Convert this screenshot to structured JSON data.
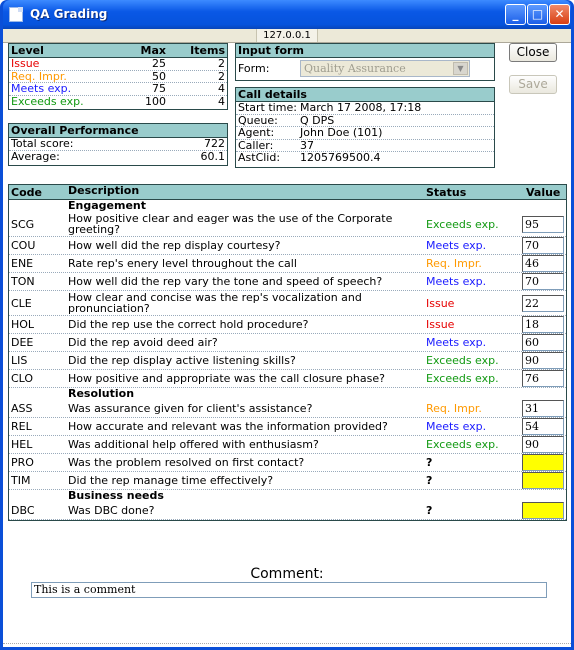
{
  "window": {
    "title": "QA Grading"
  },
  "address": "127.0.0.1",
  "levels": {
    "headers": [
      "Level",
      "Max",
      "Items"
    ],
    "rows": [
      {
        "label": "Issue",
        "max": "25",
        "items": "2",
        "cls": "c-issue"
      },
      {
        "label": "Req. Impr.",
        "max": "50",
        "items": "2",
        "cls": "c-req"
      },
      {
        "label": "Meets exp.",
        "max": "75",
        "items": "4",
        "cls": "c-meets"
      },
      {
        "label": "Exceeds exp.",
        "max": "100",
        "items": "4",
        "cls": "c-exceeds"
      }
    ]
  },
  "performance": {
    "title": "Overall Performance",
    "total_label": "Total score:",
    "total_value": "722",
    "avg_label": "Average:",
    "avg_value": "60.1"
  },
  "input_form": {
    "title": "Input form",
    "form_label": "Form:",
    "form_value": "Quality Assurance"
  },
  "call_details": {
    "title": "Call details",
    "rows": [
      {
        "k": "Start time:",
        "v": "March 17 2008, 17:18"
      },
      {
        "k": "Queue:",
        "v": "Q DPS"
      },
      {
        "k": "Agent:",
        "v": "John Doe (101)"
      },
      {
        "k": "Caller:",
        "v": "37"
      },
      {
        "k": "AstClid:",
        "v": "1205769500.4"
      }
    ]
  },
  "buttons": {
    "close": "Close",
    "save": "Save"
  },
  "table": {
    "headers": {
      "code": "Code",
      "desc": "Description",
      "status": "Status",
      "value": "Value"
    },
    "sections": [
      {
        "title": "Engagement",
        "rows": [
          {
            "code": "SCG",
            "desc": "How positive clear and eager was the use of the Corporate greeting?",
            "status": "Exceeds exp.",
            "cls": "c-exceeds",
            "value": "95",
            "tall": true
          },
          {
            "code": "COU",
            "desc": "How well did the rep display courtesy?",
            "status": "Meets exp.",
            "cls": "c-meets",
            "value": "70"
          },
          {
            "code": "ENE",
            "desc": "Rate rep's enery level throughout the call",
            "status": "Req. Impr.",
            "cls": "c-req",
            "value": "46"
          },
          {
            "code": "TON",
            "desc": "How well did the rep vary the tone and speed of speech?",
            "status": "Meets exp.",
            "cls": "c-meets",
            "value": "70"
          },
          {
            "code": "CLE",
            "desc": "How clear and concise was the rep's vocalization and pronunciation?",
            "status": "Issue",
            "cls": "c-issue",
            "value": "22",
            "tall": true
          },
          {
            "code": "HOL",
            "desc": "Did the rep use the correct hold procedure?",
            "status": "Issue",
            "cls": "c-issue",
            "value": "18"
          },
          {
            "code": "DEE",
            "desc": "Did the rep avoid deed air?",
            "status": "Meets exp.",
            "cls": "c-meets",
            "value": "60"
          },
          {
            "code": "LIS",
            "desc": "Did the rep display active listening skills?",
            "status": "Exceeds exp.",
            "cls": "c-exceeds",
            "value": "90"
          },
          {
            "code": "CLO",
            "desc": "How positive and appropriate was the call closure phase?",
            "status": "Exceeds exp.",
            "cls": "c-exceeds",
            "value": "76"
          }
        ]
      },
      {
        "title": "Resolution",
        "rows": [
          {
            "code": "ASS",
            "desc": "Was assurance given for client's assistance?",
            "status": "Req. Impr.",
            "cls": "c-req",
            "value": "31"
          },
          {
            "code": "REL",
            "desc": "How accurate and relevant was the information provided?",
            "status": "Meets exp.",
            "cls": "c-meets",
            "value": "54"
          },
          {
            "code": "HEL",
            "desc": "Was additional help offered with enthusiasm?",
            "status": "Exceeds exp.",
            "cls": "c-exceeds",
            "value": "90"
          },
          {
            "code": "PRO",
            "desc": "Was the problem resolved on first contact?",
            "status": "?",
            "cls": "",
            "value": ""
          },
          {
            "code": "TIM",
            "desc": "Did the rep manage time effectively?",
            "status": "?",
            "cls": "",
            "value": ""
          }
        ]
      },
      {
        "title": "Business needs",
        "rows": [
          {
            "code": "DBC",
            "desc": "Was DBC done?",
            "status": "?",
            "cls": "",
            "value": ""
          }
        ]
      }
    ]
  },
  "comment": {
    "title": "Comment:",
    "value": "This is a comment"
  }
}
